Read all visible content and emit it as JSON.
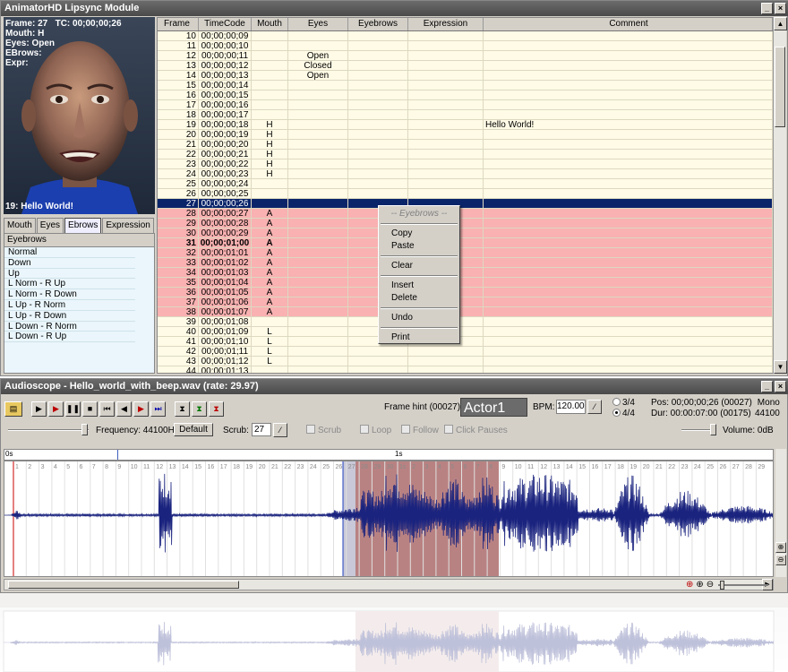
{
  "lipsync": {
    "title": "AnimatorHD Lipsync Module",
    "face_info": {
      "frame": "Frame: 27",
      "tc": "TC: 00;00;00;26",
      "mouth": "Mouth: H",
      "eyes": "Eyes: Open",
      "ebrows": "EBrows:",
      "expr": "Expr:"
    },
    "face_caption": "19: Hello World!",
    "tabs": [
      "Mouth",
      "Eyes",
      "Ebrows",
      "Expression"
    ],
    "active_tab": "Ebrows",
    "list_header": "Eyebrows",
    "list_items": [
      "Normal",
      "Down",
      "Up",
      "L Norm - R Up",
      "L Norm - R Down",
      "L Up - R Norm",
      "L Up - R Down",
      "L Down - R Norm",
      "L Down - R Up"
    ],
    "columns": [
      "Frame",
      "TimeCode",
      "Mouth",
      "Eyes",
      "Eyebrows",
      "Expression",
      "Comment"
    ],
    "rows": [
      {
        "f": "10",
        "tc": "00;00;00;09",
        "m": "",
        "e": "",
        "c": "",
        "s": ""
      },
      {
        "f": "11",
        "tc": "00;00;00;10",
        "m": "",
        "e": "",
        "c": "",
        "s": ""
      },
      {
        "f": "12",
        "tc": "00;00;00;11",
        "m": "",
        "e": "Open",
        "c": "",
        "s": ""
      },
      {
        "f": "13",
        "tc": "00;00;00;12",
        "m": "",
        "e": "Closed",
        "c": "",
        "s": ""
      },
      {
        "f": "14",
        "tc": "00;00;00;13",
        "m": "",
        "e": "Open",
        "c": "",
        "s": ""
      },
      {
        "f": "15",
        "tc": "00;00;00;14",
        "m": "",
        "e": "",
        "c": "",
        "s": ""
      },
      {
        "f": "16",
        "tc": "00;00;00;15",
        "m": "",
        "e": "",
        "c": "",
        "s": ""
      },
      {
        "f": "17",
        "tc": "00;00;00;16",
        "m": "",
        "e": "",
        "c": "",
        "s": ""
      },
      {
        "f": "18",
        "tc": "00;00;00;17",
        "m": "",
        "e": "",
        "c": "",
        "s": ""
      },
      {
        "f": "19",
        "tc": "00;00;00;18",
        "m": "H",
        "e": "",
        "c": "Hello World!",
        "s": ""
      },
      {
        "f": "20",
        "tc": "00;00;00;19",
        "m": "H",
        "e": "",
        "c": "",
        "s": ""
      },
      {
        "f": "21",
        "tc": "00;00;00;20",
        "m": "H",
        "e": "",
        "c": "",
        "s": ""
      },
      {
        "f": "22",
        "tc": "00;00;00;21",
        "m": "H",
        "e": "",
        "c": "",
        "s": ""
      },
      {
        "f": "23",
        "tc": "00;00;00;22",
        "m": "H",
        "e": "",
        "c": "",
        "s": ""
      },
      {
        "f": "24",
        "tc": "00;00;00;23",
        "m": "H",
        "e": "",
        "c": "",
        "s": ""
      },
      {
        "f": "25",
        "tc": "00;00;00;24",
        "m": "",
        "e": "",
        "c": "",
        "s": ""
      },
      {
        "f": "26",
        "tc": "00;00;00;25",
        "m": "",
        "e": "",
        "c": "",
        "s": ""
      },
      {
        "f": "27",
        "tc": "00;00;00;26",
        "m": "",
        "e": "",
        "c": "",
        "s": "sel"
      },
      {
        "f": "28",
        "tc": "00;00;00;27",
        "m": "A",
        "e": "",
        "c": "",
        "s": "pink"
      },
      {
        "f": "29",
        "tc": "00;00;00;28",
        "m": "A",
        "e": "",
        "c": "",
        "s": "pink"
      },
      {
        "f": "30",
        "tc": "00;00;00;29",
        "m": "A",
        "e": "",
        "c": "",
        "s": "pink"
      },
      {
        "f": "31",
        "tc": "00;00;01;00",
        "m": "A",
        "e": "",
        "c": "",
        "s": "pink bold"
      },
      {
        "f": "32",
        "tc": "00;00;01;01",
        "m": "A",
        "e": "",
        "c": "",
        "s": "pink"
      },
      {
        "f": "33",
        "tc": "00;00;01;02",
        "m": "A",
        "e": "",
        "c": "",
        "s": "pink"
      },
      {
        "f": "34",
        "tc": "00;00;01;03",
        "m": "A",
        "e": "",
        "c": "",
        "s": "pink"
      },
      {
        "f": "35",
        "tc": "00;00;01;04",
        "m": "A",
        "e": "",
        "c": "",
        "s": "pink"
      },
      {
        "f": "36",
        "tc": "00;00;01;05",
        "m": "A",
        "e": "",
        "c": "",
        "s": "pink"
      },
      {
        "f": "37",
        "tc": "00;00;01;06",
        "m": "A",
        "e": "",
        "c": "",
        "s": "pink"
      },
      {
        "f": "38",
        "tc": "00;00;01;07",
        "m": "A",
        "e": "",
        "c": "",
        "s": "pink"
      },
      {
        "f": "39",
        "tc": "00;00;01;08",
        "m": "",
        "e": "",
        "c": "",
        "s": ""
      },
      {
        "f": "40",
        "tc": "00;00;01;09",
        "m": "L",
        "e": "",
        "c": "",
        "s": ""
      },
      {
        "f": "41",
        "tc": "00;00;01;10",
        "m": "L",
        "e": "",
        "c": "",
        "s": ""
      },
      {
        "f": "42",
        "tc": "00;00;01;11",
        "m": "L",
        "e": "",
        "c": "",
        "s": ""
      },
      {
        "f": "43",
        "tc": "00;00;01;12",
        "m": "L",
        "e": "",
        "c": "",
        "s": ""
      },
      {
        "f": "44",
        "tc": "00;00;01;13",
        "m": "",
        "e": "",
        "c": "",
        "s": ""
      }
    ],
    "context_menu": {
      "header": "-- Eyebrows --",
      "groups": [
        [
          "Copy",
          "Paste"
        ],
        [
          "Clear"
        ],
        [
          "Insert",
          "Delete"
        ],
        [
          "Undo"
        ],
        [
          "Print"
        ]
      ]
    }
  },
  "audio": {
    "title": "Audioscope - Hello_world_with_beep.wav (rate: 29.97)",
    "frame_hint": "Frame hint (00027):",
    "actor": "Actor1",
    "bpm_label": "BPM:",
    "bpm_value": "120.00",
    "time_sigs": [
      "3/4",
      "4/4"
    ],
    "time_sig_selected": "4/4",
    "pos": "Pos: 00;00;00;26 (00027)",
    "dur": "Dur: 00:00:07:00 (00175)",
    "channels": "Mono",
    "rate": "44100",
    "frequency_label": "Frequency: 44100Hz",
    "default_label": "Default",
    "scrub_label": "Scrub:",
    "scrub_value": "27",
    "checks": [
      "Scrub",
      "Loop",
      "Follow",
      "Click Pauses"
    ],
    "volume_label": "Volume: 0dB",
    "timeline_marks": [
      "0s",
      "1s"
    ],
    "frame_ticks": [
      "1",
      "2",
      "3",
      "4",
      "5",
      "6",
      "7",
      "8",
      "9",
      "10",
      "11",
      "12",
      "13",
      "14",
      "15",
      "16",
      "17",
      "18",
      "19",
      "20",
      "21",
      "22",
      "23",
      "24",
      "25",
      "26",
      "27",
      "28",
      "29",
      "30",
      "1s",
      "2",
      "3",
      "4",
      "5",
      "6",
      "7",
      "8",
      "9",
      "10",
      "11",
      "12",
      "13",
      "14",
      "15",
      "16",
      "17",
      "18",
      "19",
      "20",
      "21",
      "22",
      "23",
      "24",
      "25",
      "26",
      "27",
      "28",
      "29"
    ],
    "colors": {
      "wave": "#1a237e",
      "selection": "#b98282",
      "panel": "#d4d0c8"
    }
  }
}
